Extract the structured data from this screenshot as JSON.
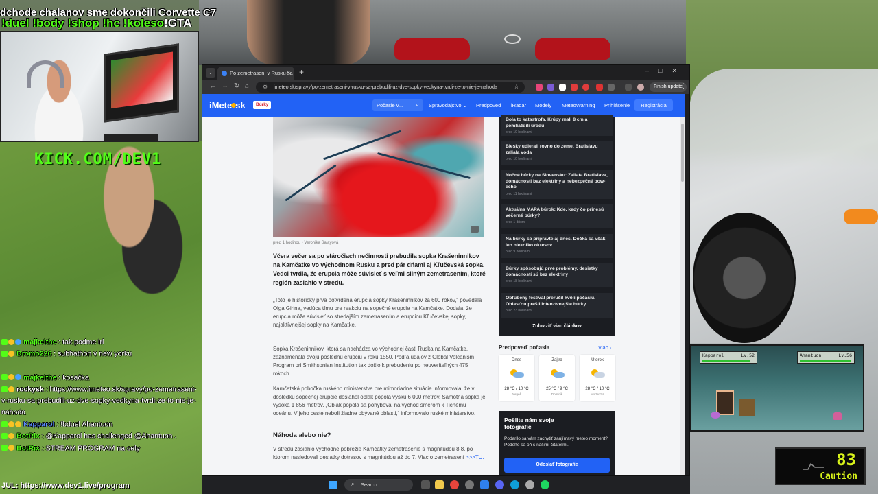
{
  "overlay": {
    "line1": "dchode chalanov sme dokončili Corvette C7",
    "commands": "!duel !body !shop !hc !koleso",
    "gta": "!GTA",
    "kick": "KICK.COM/DEV1"
  },
  "chat": {
    "messages": [
      {
        "user": "majkelthe",
        "text": " : tak podme irl",
        "color": "#53fc18"
      },
      {
        "user": "Dromo226",
        "text": " : subhathon v new yorku",
        "color": "#53fc18"
      },
      {
        "user": "majkelthe",
        "text": " : kosačka",
        "color": "#53fc18"
      },
      {
        "user": "rockysk",
        "text": " : https://www.imeteo.sk/spravy/po-zemetraseni-v-rusku-sa-prebudili-uz-dve-sopky-vedkyna-tvrdi-ze-to-nie-je-nahoda",
        "color": "#ffffff"
      },
      {
        "user": "Kapparol",
        "text": " : !bduel Ahantuon",
        "color": "#5b8cff"
      },
      {
        "user": "BotRix",
        "text": " : @Kapparol has challenged @Ahantuon .",
        "color": "#53fc18"
      },
      {
        "user": "BotRix",
        "text": " : STREAM PROGRAM na cely",
        "color": "#53fc18"
      }
    ],
    "footer": "JUL: https://www.dev1.live/program"
  },
  "game": {
    "player1": "Kapparol",
    "player1_level": "Lv.52",
    "player2": "Ahantuon",
    "player2_level": "Lv.56"
  },
  "caution": {
    "value": "83",
    "label": "Caution"
  },
  "browser": {
    "tab_title": "Po zemetrasení v Rusku sa prebudili",
    "url": "imeteo.sk/spravy/po-zemetraseni-v-rusku-sa-prebudili-uz-dve-sopky-vedkyna-tvrdi-ze-to-nie-je-nahoda",
    "finish_update": "Finish update"
  },
  "site": {
    "logo_prefix": "iMete",
    "logo_suffix": "sk",
    "storm_badge": "Búrky",
    "search_label": "Počasie v...",
    "nav": [
      "Spravodajstvo ⌄",
      "Predpoveď",
      "iRadar",
      "Modely",
      "MeteoWarning",
      "Prihlásenie"
    ],
    "register": "Registrácia",
    "article": {
      "meta": "pred 1 hodinou  •  Veronika Salayová",
      "lead": "Včera večer sa po stáročiach nečinnosti prebudila sopka Krašeninnikov na Kamčatke vo východnom Rusku a pred pár dňami aj Kľučevská sopka. Vedci tvrdia, že erupcia môže súvisieť s veľmi silným zemetrasením, ktoré región zasiahlo v stredu.",
      "p1": "„Toto je historicky prvá potvrdená erupcia sopky Krašeninnikov za 600 rokov,“ povedala Olga Girina, vedúca tímu pre reakciu na sopečné erupcie na Kamčatke. Dodala, že erupcia môže súvisieť so stredajším zemetrasením a erupciou Kľučevskej sopky, najaktívnejšej sopky na Kamčatke.",
      "p2": "Sopka Krašeninnikov, ktorá sa nachádza vo východnej časti Ruska na Kamčatke, zaznamenala svoju poslednú erupciu v roku 1550. Podľa údajov z Global Volcanism Program pri Smithsonian Institution tak došlo k prebudeniu po neuveriteľných 475 rokoch.",
      "p3": "Kamčatská pobočka ruského ministerstva pre mimoriadne situácie informovala, že v dôsledku sopečnej erupcie dosiahol oblak popola výšku 6 000 metrov. Samotná sopka je vysoká 1 856 metrov. „Oblak popola sa pohyboval na východ smerom k Tichému oceánu. V jeho ceste neboli žiadne obývané oblasti,“ informovalo ruské ministerstvo.",
      "h2": "Náhoda alebo nie?",
      "p4": "V stredu zasiahlo východné pobrežie Kamčatky zemetrasenie s magnitúdou 8,8, po ktorom nasledovali desiatky dotrasov s magnitúdou až do 7. Viac o zemetrasení ",
      "p4_link": ">>>TU."
    },
    "sidebar_news": [
      {
        "title": "Bola to katastrofa. Krúpy mali 8 cm a pomliaždili úrodu",
        "time": "pred 10 hodinami"
      },
      {
        "title": "Blesky udierali rovno do zeme, Bratislavu zaliala voda",
        "time": "pred 10 hodinami"
      },
      {
        "title": "Nočné búrky na Slovensku: Zaliata Bratislava, domácnosti bez elektriny a nebezpečné bow-echo",
        "time": "pred 11 hodinami"
      },
      {
        "title": "Aktuálna MAPA búrok: Kde, kedy čo prinesú večerné búrky?",
        "time": "pred 1 dňom"
      },
      {
        "title": "Na búrky sa pripravte aj dnes. Dočká sa však len niekoľko okresov",
        "time": "pred 9 hodinami"
      },
      {
        "title": "Búrky spôsobujú prvé problémy, desiatky domácností sú bez elektriny",
        "time": "pred 18 hodinami"
      },
      {
        "title": "Obľúbený festival prerušil kvôli počasiu. Oblasťou prešli intenzívnejšie búrky",
        "time": "pred 23 hodinami"
      }
    ],
    "sidebar_more": "Zobraziť viac článkov",
    "forecast": {
      "title": "Predpoveď počasia",
      "more": "Viac",
      "days": [
        {
          "day": "Dnes",
          "temp": "28 °C / 10 °C",
          "saint": "Jergeš"
        },
        {
          "day": "Zajtra",
          "temp": "25 °C / 9 °C",
          "saint": "Dominik"
        },
        {
          "day": "Utorok",
          "temp": "28 °C / 10 °C",
          "saint": "Hortenzia"
        }
      ]
    },
    "photo_card": {
      "title": "Pošlite nám svoje fotografie",
      "text": "Podarilo sa vám zachytiť zaujímavý meteo moment? Podeľte sa oň s našimi čitateľmi.",
      "button": "Odoslať fotografie"
    }
  },
  "taskbar": {
    "search": "Search"
  }
}
